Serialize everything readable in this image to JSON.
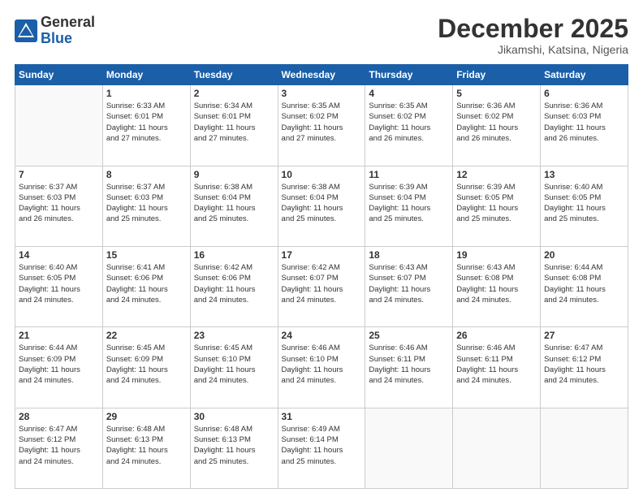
{
  "logo": {
    "general": "General",
    "blue": "Blue"
  },
  "header": {
    "month": "December 2025",
    "location": "Jikamshi, Katsina, Nigeria"
  },
  "weekdays": [
    "Sunday",
    "Monday",
    "Tuesday",
    "Wednesday",
    "Thursday",
    "Friday",
    "Saturday"
  ],
  "weeks": [
    [
      {
        "day": "",
        "content": ""
      },
      {
        "day": "1",
        "content": "Sunrise: 6:33 AM\nSunset: 6:01 PM\nDaylight: 11 hours\nand 27 minutes."
      },
      {
        "day": "2",
        "content": "Sunrise: 6:34 AM\nSunset: 6:01 PM\nDaylight: 11 hours\nand 27 minutes."
      },
      {
        "day": "3",
        "content": "Sunrise: 6:35 AM\nSunset: 6:02 PM\nDaylight: 11 hours\nand 27 minutes."
      },
      {
        "day": "4",
        "content": "Sunrise: 6:35 AM\nSunset: 6:02 PM\nDaylight: 11 hours\nand 26 minutes."
      },
      {
        "day": "5",
        "content": "Sunrise: 6:36 AM\nSunset: 6:02 PM\nDaylight: 11 hours\nand 26 minutes."
      },
      {
        "day": "6",
        "content": "Sunrise: 6:36 AM\nSunset: 6:03 PM\nDaylight: 11 hours\nand 26 minutes."
      }
    ],
    [
      {
        "day": "7",
        "content": "Sunrise: 6:37 AM\nSunset: 6:03 PM\nDaylight: 11 hours\nand 26 minutes."
      },
      {
        "day": "8",
        "content": "Sunrise: 6:37 AM\nSunset: 6:03 PM\nDaylight: 11 hours\nand 25 minutes."
      },
      {
        "day": "9",
        "content": "Sunrise: 6:38 AM\nSunset: 6:04 PM\nDaylight: 11 hours\nand 25 minutes."
      },
      {
        "day": "10",
        "content": "Sunrise: 6:38 AM\nSunset: 6:04 PM\nDaylight: 11 hours\nand 25 minutes."
      },
      {
        "day": "11",
        "content": "Sunrise: 6:39 AM\nSunset: 6:04 PM\nDaylight: 11 hours\nand 25 minutes."
      },
      {
        "day": "12",
        "content": "Sunrise: 6:39 AM\nSunset: 6:05 PM\nDaylight: 11 hours\nand 25 minutes."
      },
      {
        "day": "13",
        "content": "Sunrise: 6:40 AM\nSunset: 6:05 PM\nDaylight: 11 hours\nand 25 minutes."
      }
    ],
    [
      {
        "day": "14",
        "content": "Sunrise: 6:40 AM\nSunset: 6:05 PM\nDaylight: 11 hours\nand 24 minutes."
      },
      {
        "day": "15",
        "content": "Sunrise: 6:41 AM\nSunset: 6:06 PM\nDaylight: 11 hours\nand 24 minutes."
      },
      {
        "day": "16",
        "content": "Sunrise: 6:42 AM\nSunset: 6:06 PM\nDaylight: 11 hours\nand 24 minutes."
      },
      {
        "day": "17",
        "content": "Sunrise: 6:42 AM\nSunset: 6:07 PM\nDaylight: 11 hours\nand 24 minutes."
      },
      {
        "day": "18",
        "content": "Sunrise: 6:43 AM\nSunset: 6:07 PM\nDaylight: 11 hours\nand 24 minutes."
      },
      {
        "day": "19",
        "content": "Sunrise: 6:43 AM\nSunset: 6:08 PM\nDaylight: 11 hours\nand 24 minutes."
      },
      {
        "day": "20",
        "content": "Sunrise: 6:44 AM\nSunset: 6:08 PM\nDaylight: 11 hours\nand 24 minutes."
      }
    ],
    [
      {
        "day": "21",
        "content": "Sunrise: 6:44 AM\nSunset: 6:09 PM\nDaylight: 11 hours\nand 24 minutes."
      },
      {
        "day": "22",
        "content": "Sunrise: 6:45 AM\nSunset: 6:09 PM\nDaylight: 11 hours\nand 24 minutes."
      },
      {
        "day": "23",
        "content": "Sunrise: 6:45 AM\nSunset: 6:10 PM\nDaylight: 11 hours\nand 24 minutes."
      },
      {
        "day": "24",
        "content": "Sunrise: 6:46 AM\nSunset: 6:10 PM\nDaylight: 11 hours\nand 24 minutes."
      },
      {
        "day": "25",
        "content": "Sunrise: 6:46 AM\nSunset: 6:11 PM\nDaylight: 11 hours\nand 24 minutes."
      },
      {
        "day": "26",
        "content": "Sunrise: 6:46 AM\nSunset: 6:11 PM\nDaylight: 11 hours\nand 24 minutes."
      },
      {
        "day": "27",
        "content": "Sunrise: 6:47 AM\nSunset: 6:12 PM\nDaylight: 11 hours\nand 24 minutes."
      }
    ],
    [
      {
        "day": "28",
        "content": "Sunrise: 6:47 AM\nSunset: 6:12 PM\nDaylight: 11 hours\nand 24 minutes."
      },
      {
        "day": "29",
        "content": "Sunrise: 6:48 AM\nSunset: 6:13 PM\nDaylight: 11 hours\nand 24 minutes."
      },
      {
        "day": "30",
        "content": "Sunrise: 6:48 AM\nSunset: 6:13 PM\nDaylight: 11 hours\nand 25 minutes."
      },
      {
        "day": "31",
        "content": "Sunrise: 6:49 AM\nSunset: 6:14 PM\nDaylight: 11 hours\nand 25 minutes."
      },
      {
        "day": "",
        "content": ""
      },
      {
        "day": "",
        "content": ""
      },
      {
        "day": "",
        "content": ""
      }
    ]
  ]
}
